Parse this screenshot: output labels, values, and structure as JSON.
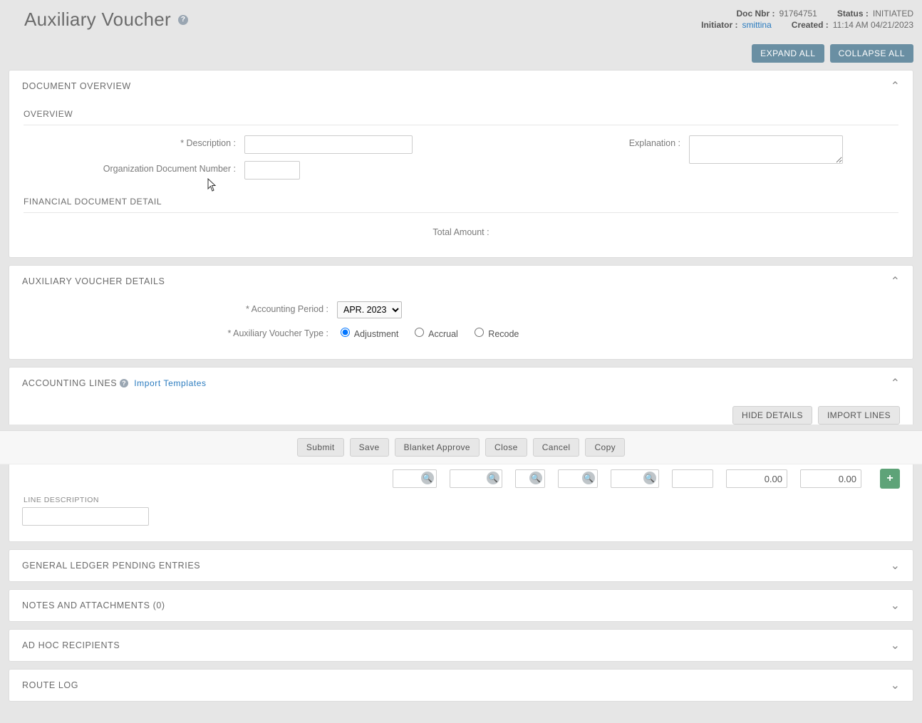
{
  "header": {
    "title": "Auxiliary Voucher",
    "meta": {
      "doc_nbr_label": "Doc Nbr :",
      "doc_nbr": "91764751",
      "status_label": "Status :",
      "status": "INITIATED",
      "initiator_label": "Initiator :",
      "initiator": "smittina",
      "created_label": "Created :",
      "created": "11:14 AM 04/21/2023"
    },
    "buttons": {
      "expand": "EXPAND ALL",
      "collapse": "COLLAPSE ALL"
    }
  },
  "doc_overview": {
    "title": "DOCUMENT OVERVIEW",
    "overview_title": "OVERVIEW",
    "description_label": "* Description :",
    "description_value": "",
    "org_doc_label": "Organization Document Number :",
    "org_doc_value": "",
    "explanation_label": "Explanation :",
    "explanation_value": "",
    "fin_detail_title": "FINANCIAL DOCUMENT DETAIL",
    "total_label": "Total Amount :"
  },
  "aux_details": {
    "title": "AUXILIARY VOUCHER DETAILS",
    "period_label": "* Accounting Period :",
    "period_value": "APR. 2023",
    "type_label": "* Auxiliary Voucher Type :",
    "types": {
      "adjustment": "Adjustment",
      "accrual": "Accrual",
      "recode": "Recode"
    }
  },
  "acct_lines": {
    "title": "ACCOUNTING LINES",
    "import_templates": "Import Templates",
    "hide_details": "HIDE DETAILS",
    "import_lines": "IMPORT LINES",
    "line_desc_label": "LINE DESCRIPTION",
    "line_desc_value": "",
    "amount1": "0.00",
    "amount2": "0.00"
  },
  "actions": {
    "submit": "Submit",
    "save": "Save",
    "blanket": "Blanket Approve",
    "close": "Close",
    "cancel": "Cancel",
    "copy": "Copy"
  },
  "collapsed_panels": {
    "gl": "GENERAL LEDGER PENDING ENTRIES",
    "notes": "NOTES AND ATTACHMENTS (0)",
    "adhoc": "AD HOC RECIPIENTS",
    "route": "ROUTE LOG"
  }
}
